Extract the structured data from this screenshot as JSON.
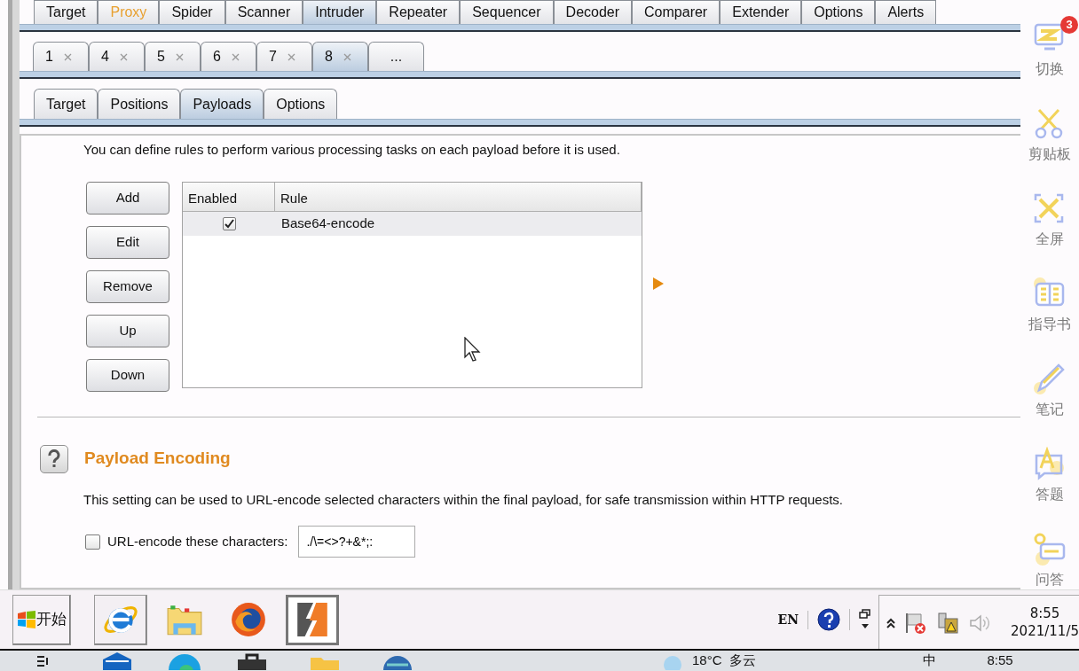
{
  "main_tabs": [
    {
      "label": "Target",
      "selected": false,
      "highlighted": false
    },
    {
      "label": "Proxy",
      "selected": false,
      "highlighted": true
    },
    {
      "label": "Spider",
      "selected": false,
      "highlighted": false
    },
    {
      "label": "Scanner",
      "selected": false,
      "highlighted": false
    },
    {
      "label": "Intruder",
      "selected": true,
      "highlighted": false
    },
    {
      "label": "Repeater",
      "selected": false,
      "highlighted": false
    },
    {
      "label": "Sequencer",
      "selected": false,
      "highlighted": false
    },
    {
      "label": "Decoder",
      "selected": false,
      "highlighted": false
    },
    {
      "label": "Comparer",
      "selected": false,
      "highlighted": false
    },
    {
      "label": "Extender",
      "selected": false,
      "highlighted": false
    },
    {
      "label": "Options",
      "selected": false,
      "highlighted": false
    },
    {
      "label": "Alerts",
      "selected": false,
      "highlighted": false
    }
  ],
  "request_tabs": [
    {
      "label": "1",
      "selected": false,
      "closable": true
    },
    {
      "label": "4",
      "selected": false,
      "closable": true
    },
    {
      "label": "5",
      "selected": false,
      "closable": true
    },
    {
      "label": "6",
      "selected": false,
      "closable": true
    },
    {
      "label": "7",
      "selected": false,
      "closable": true
    },
    {
      "label": "8",
      "selected": true,
      "closable": true
    },
    {
      "label": "...",
      "selected": false,
      "closable": false
    }
  ],
  "sub_tabs": [
    {
      "label": "Target",
      "selected": false
    },
    {
      "label": "Positions",
      "selected": false
    },
    {
      "label": "Payloads",
      "selected": true
    },
    {
      "label": "Options",
      "selected": false
    }
  ],
  "processing": {
    "description": "You can define rules to perform various processing tasks on each payload before it is used.",
    "buttons": [
      "Add",
      "Edit",
      "Remove",
      "Up",
      "Down"
    ],
    "table": {
      "columns": [
        "Enabled",
        "Rule"
      ],
      "rows": [
        {
          "enabled": true,
          "rule": "Base64-encode",
          "selected": true
        }
      ]
    }
  },
  "encoding": {
    "title": "Payload Encoding",
    "description": "This setting can be used to URL-encode selected characters within the final payload, for safe transmission within HTTP requests.",
    "checkbox": {
      "label": "URL-encode these characters:",
      "checked": false
    },
    "characters": "./\\=<>?+&*;:"
  },
  "sidebar": {
    "badge": "3",
    "items": [
      {
        "kind": "switch",
        "label": "切换"
      },
      {
        "kind": "clipboard",
        "label": "剪贴板"
      },
      {
        "kind": "fullscreen",
        "label": "全屏"
      },
      {
        "kind": "guide",
        "label": "指导书"
      },
      {
        "kind": "notes",
        "label": "笔记"
      },
      {
        "kind": "answer",
        "label": "答题"
      },
      {
        "kind": "qa",
        "label": "问答"
      }
    ]
  },
  "taskbar": {
    "start_label": "开始",
    "apps": [
      {
        "kind": "ie",
        "selected": false
      },
      {
        "kind": "folder",
        "selected": false
      },
      {
        "kind": "firefox",
        "selected": false
      },
      {
        "kind": "burp",
        "selected": true
      }
    ],
    "tray": {
      "language": "EN",
      "time": "8:55",
      "date": "2021/11/5"
    }
  },
  "host_taskbar": {
    "weather": "18°C",
    "condition": "多云",
    "ime": "中",
    "time": "8:55"
  }
}
